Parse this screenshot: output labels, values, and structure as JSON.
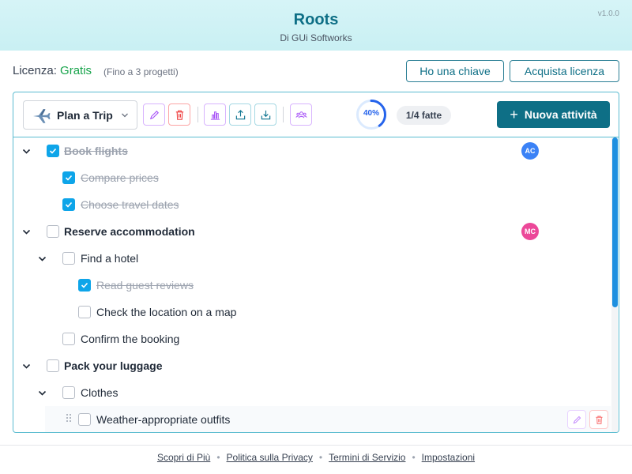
{
  "header": {
    "title": "Roots",
    "subtitle": "Di GUi Softworks",
    "version": "v1.0.0"
  },
  "license": {
    "label": "Licenza:",
    "plan": "Gratis",
    "note": "(Fino a 3 progetti)",
    "have_key_label": "Ho una chiave",
    "buy_label": "Acquista licenza"
  },
  "toolbar": {
    "project_name": "Plan a Trip",
    "project_icon": "airplane-icon",
    "progress_text": "40%",
    "progress_fraction": 0.4,
    "done_text": "1/4 fatte",
    "new_task_label": "Nuova attività",
    "icons": [
      "edit-icon",
      "trash-icon",
      "chart-icon",
      "upload-icon",
      "download-icon",
      "users-icon"
    ]
  },
  "tasks": [
    {
      "label": "Book flights",
      "checked": true,
      "bold": true,
      "expanded": true,
      "avatar": "AC",
      "avatar_color": "#3b82f6"
    },
    {
      "label": "Compare prices",
      "checked": true
    },
    {
      "label": "Choose travel dates",
      "checked": true
    },
    {
      "label": "Reserve accommodation",
      "checked": false,
      "bold": true,
      "expanded": true,
      "avatar": "MC",
      "avatar_color": "#ec4899"
    },
    {
      "label": "Find a hotel",
      "checked": false,
      "expanded": true
    },
    {
      "label": "Read guest reviews",
      "checked": true
    },
    {
      "label": "Check the location on a map",
      "checked": false
    },
    {
      "label": "Confirm the booking",
      "checked": false
    },
    {
      "label": "Pack your luggage",
      "checked": false,
      "bold": true,
      "expanded": true
    },
    {
      "label": "Clothes",
      "checked": false,
      "expanded": true
    },
    {
      "label": "Weather-appropriate outfits",
      "checked": false,
      "hovered": true
    }
  ],
  "footer": {
    "links": [
      "Scopri di Più",
      "Politica sulla Privacy",
      "Termini di Servizio",
      "Impostazioni"
    ]
  },
  "colors": {
    "accent": "#0e6f86",
    "check": "#0ea5e9",
    "license_plan": "#16a34a",
    "progress": "#2563eb"
  }
}
